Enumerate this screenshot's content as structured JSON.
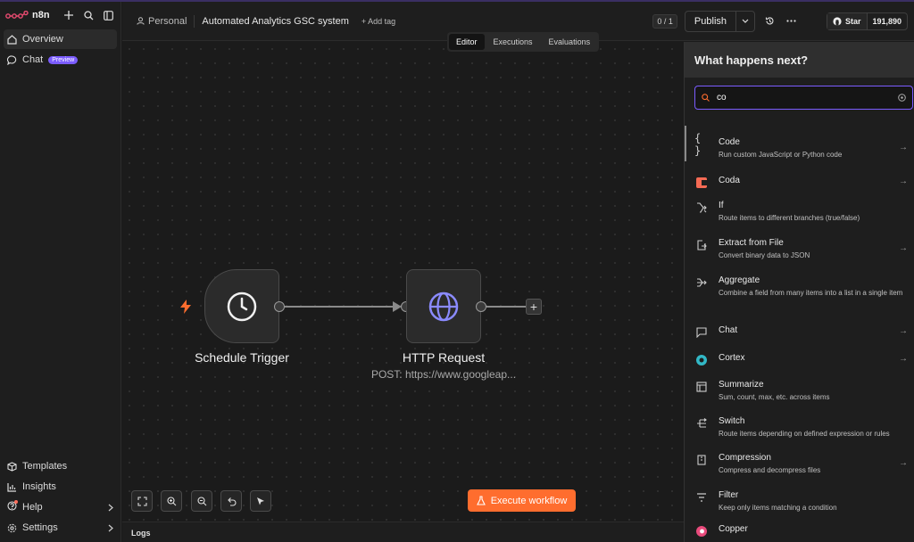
{
  "app": {
    "name": "n8n"
  },
  "sidebar": {
    "items": [
      {
        "label": "Overview",
        "icon": "home-icon",
        "active": true
      },
      {
        "label": "Chat",
        "icon": "chat-icon",
        "badge": "Preview"
      }
    ],
    "bottom": [
      {
        "label": "Templates",
        "icon": "box-icon"
      },
      {
        "label": "Insights",
        "icon": "chart-icon"
      },
      {
        "label": "Help",
        "icon": "help-icon"
      },
      {
        "label": "Settings",
        "icon": "gear-icon"
      }
    ]
  },
  "topbar": {
    "project": "Personal",
    "workflow_name": "Automated Analytics GSC system",
    "add_tag": "+ Add tag",
    "counter": "0 / 1",
    "publish": "Publish"
  },
  "github": {
    "star_label": "Star",
    "count": "191,890"
  },
  "tabs": [
    "Editor",
    "Executions",
    "Evaluations"
  ],
  "nodes": {
    "trigger": {
      "label": "Schedule Trigger"
    },
    "http": {
      "label": "HTTP Request",
      "subtitle": "POST: https://www.googleap..."
    }
  },
  "execute_button": "Execute workflow",
  "logs_label": "Logs",
  "panel": {
    "title": "What happens next?",
    "search_value": "co",
    "results": [
      {
        "title": "Code",
        "desc": "Run custom JavaScript or Python code",
        "icon": "code-icon"
      },
      {
        "title": "Coda",
        "desc": "",
        "icon": "coda-icon"
      },
      {
        "title": "If",
        "desc": "Route items to different branches (true/false)",
        "icon": "branch-icon"
      },
      {
        "title": "Extract from File",
        "desc": "Convert binary data to JSON",
        "icon": "file-export-icon"
      },
      {
        "title": "Aggregate",
        "desc": "Combine a field from many items into a list in a single item",
        "icon": "aggregate-icon"
      },
      {
        "title": "Chat",
        "desc": "",
        "icon": "chat-bubble-icon"
      },
      {
        "title": "Cortex",
        "desc": "",
        "icon": "cortex-icon"
      },
      {
        "title": "Summarize",
        "desc": "Sum, count, max, etc. across items",
        "icon": "table-icon"
      },
      {
        "title": "Switch",
        "desc": "Route items depending on defined expression or rules",
        "icon": "switch-icon"
      },
      {
        "title": "Compression",
        "desc": "Compress and decompress files",
        "icon": "compress-icon"
      },
      {
        "title": "Filter",
        "desc": "Keep only items matching a condition",
        "icon": "filter-icon"
      },
      {
        "title": "Copper",
        "desc": "",
        "icon": "copper-icon"
      }
    ]
  },
  "colors": {
    "accent": "#ff6d2e",
    "focus": "#7b5cff",
    "brand": "#ea4b71"
  }
}
